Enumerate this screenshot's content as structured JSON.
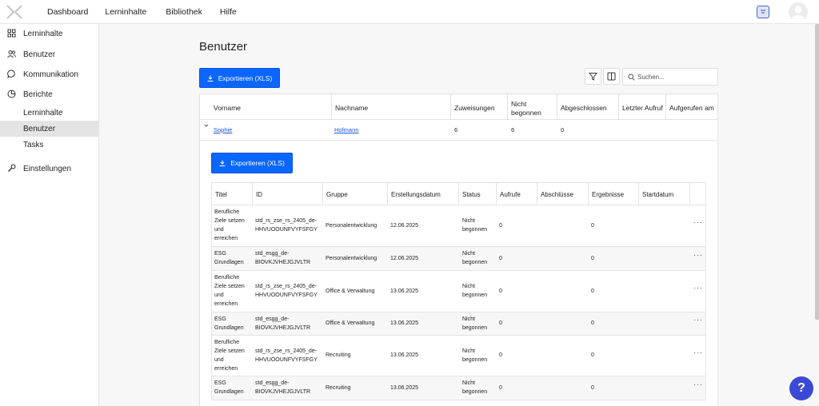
{
  "nav": {
    "items": [
      "Dashboard",
      "Lerninhalte",
      "Bibliothek",
      "Hilfe"
    ]
  },
  "sidebar": {
    "lerninhalte": "Lerninhalte",
    "benutzer": "Benutzer",
    "kommunikation": "Kommunikation",
    "berichte": "Berichte",
    "sub": [
      "Lerninhalte",
      "Benutzer",
      "Tasks"
    ],
    "einstellungen": "Einstellungen"
  },
  "page": {
    "title": "Benutzer",
    "export_label": "Exportieren (XLS)",
    "search_placeholder": "Suchen..."
  },
  "user_table": {
    "headers": [
      "Vorname",
      "Nachname",
      "Zuweisungen",
      "Nicht begonnen",
      "Abgeschlossen",
      "Letzter Aufruf",
      "Aufgerufen am"
    ],
    "row": {
      "vorname": "Sophie",
      "nachname": "Hofmann",
      "zuweisungen": "6",
      "nicht_begonnen": "6",
      "abgeschlossen": "0"
    }
  },
  "detail": {
    "export_label": "Exportieren (XLS)",
    "headers": [
      "Titel",
      "ID",
      "Gruppe",
      "Erstellungsdatum",
      "Status",
      "Aufrufe",
      "Abschlüsse",
      "Ergebnisse",
      "Startdatum"
    ],
    "rows": [
      {
        "titel": [
          "Berufliche",
          "Ziele setzen",
          "und",
          "erreichen"
        ],
        "id": [
          "std_rs_zse_rs_2405_de-",
          "HHVUOOUNFVYFSFGY"
        ],
        "gruppe": "Personalentwicklung",
        "datum": "12.06.2025",
        "status": [
          "Nicht",
          "begonnen"
        ],
        "aufrufe": "0",
        "ergebnisse": "0"
      },
      {
        "titel": [
          "ESG",
          "Grundlagen"
        ],
        "id": [
          "std_esgg_de-",
          "BIOVKJVHEJGJVLTR"
        ],
        "gruppe": "Personalentwicklung",
        "datum": "12.06.2025",
        "status": [
          "Nicht",
          "begonnen"
        ],
        "aufrufe": "0",
        "ergebnisse": "0"
      },
      {
        "titel": [
          "Berufliche",
          "Ziele setzen",
          "und",
          "erreichen"
        ],
        "id": [
          "std_rs_zse_rs_2405_de-",
          "HHVUOOUNFVYFSFGY"
        ],
        "gruppe": "Office & Verwaltung",
        "datum": "13.06.2025",
        "status": [
          "Nicht",
          "begonnen"
        ],
        "aufrufe": "0",
        "ergebnisse": "0"
      },
      {
        "titel": [
          "ESG",
          "Grundlagen"
        ],
        "id": [
          "std_esgg_de-",
          "BIOVKJVHEJGJVLTR"
        ],
        "gruppe": "Office & Verwaltung",
        "datum": "13.06.2025",
        "status": [
          "Nicht",
          "begonnen"
        ],
        "aufrufe": "0",
        "ergebnisse": "0"
      },
      {
        "titel": [
          "Berufliche",
          "Ziele setzen",
          "und",
          "erreichen"
        ],
        "id": [
          "std_rs_zse_rs_2405_de-",
          "HHVUOOUNFVYFSFGY"
        ],
        "gruppe": "Recruiting",
        "datum": "13.06.2025",
        "status": [
          "Nicht",
          "begonnen"
        ],
        "aufrufe": "0",
        "ergebnisse": "0"
      },
      {
        "titel": [
          "ESG",
          "Grundlagen"
        ],
        "id": [
          "std_esgg_de-",
          "BIOVKJVHEJGJVLTR"
        ],
        "gruppe": "Recruiting",
        "datum": "13.06.2025",
        "status": [
          "Nicht",
          "begonnen"
        ],
        "aufrufe": "0",
        "ergebnisse": "0"
      }
    ]
  },
  "help": {
    "label": "?"
  },
  "colors": {
    "primary": "#0a66ff",
    "link": "#1a55d6",
    "help": "#3b49d6"
  }
}
